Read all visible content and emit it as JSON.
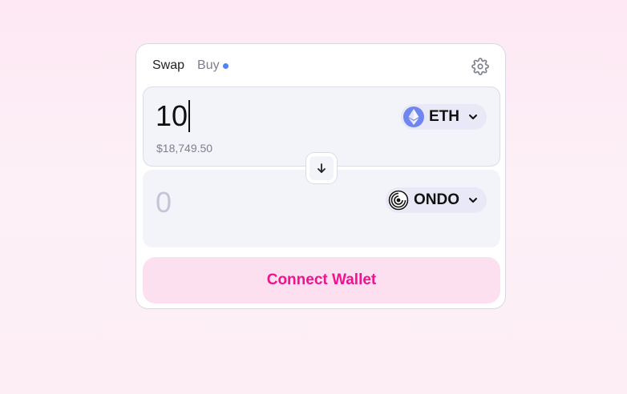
{
  "tabs": {
    "swap": "Swap",
    "buy": "Buy"
  },
  "icons": {
    "settings": "gear-icon",
    "swap_direction": "arrow-down-icon",
    "dropdown": "chevron-down-icon"
  },
  "sell": {
    "amount": "10",
    "usd_value": "$18,749.50",
    "token": {
      "symbol": "ETH",
      "icon": "eth-icon"
    }
  },
  "buy": {
    "amount_placeholder": "0",
    "token": {
      "symbol": "ONDO",
      "icon": "ondo-icon"
    }
  },
  "connect_button": "Connect Wallet",
  "colors": {
    "accent": "#f0128f",
    "accent_bg": "#fde0ef",
    "indicator_dot": "#4c82fb",
    "eth": "#6f86f0"
  }
}
